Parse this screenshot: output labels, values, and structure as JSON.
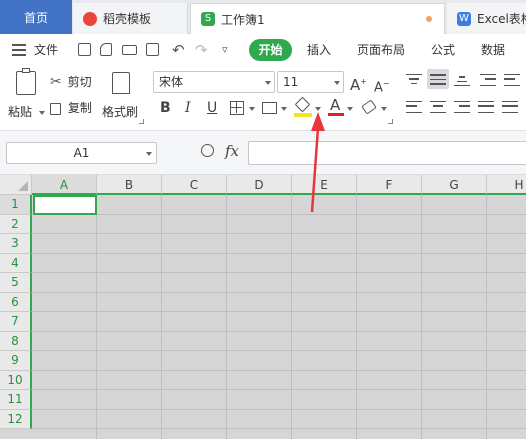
{
  "tabs": {
    "home": "首页",
    "wps_template": "稻壳模板",
    "workbook": "工作簿1",
    "excel": "Excel表格"
  },
  "menu": {
    "file": "文件",
    "items": [
      "开始",
      "插入",
      "页面布局",
      "公式",
      "数据"
    ]
  },
  "ribbon": {
    "paste": "粘贴",
    "cut": "剪切",
    "copy": "复制",
    "format_painter": "格式刷",
    "font_name": "宋体",
    "font_size": "11",
    "bold": "B",
    "italic": "I",
    "underline": "U",
    "font_color_glyph": "A"
  },
  "formula_bar": {
    "name_box": "A1",
    "fx": "fx",
    "value": ""
  },
  "sheet": {
    "columns": [
      "A",
      "B",
      "C",
      "D",
      "E",
      "F",
      "G",
      "H"
    ],
    "rows": [
      "1",
      "2",
      "3",
      "4",
      "5",
      "6",
      "7",
      "8",
      "9",
      "10",
      "11",
      "12"
    ],
    "active_cell": "A1"
  },
  "colors": {
    "home_tab": "#4373c6",
    "accent_green": "#2fa84f",
    "annotation_arrow": "#e8363a",
    "fill_highlight": "#f2e41d",
    "font_color_red": "#e02020"
  },
  "annotation": {
    "type": "arrow",
    "target": "fill-color-button"
  }
}
